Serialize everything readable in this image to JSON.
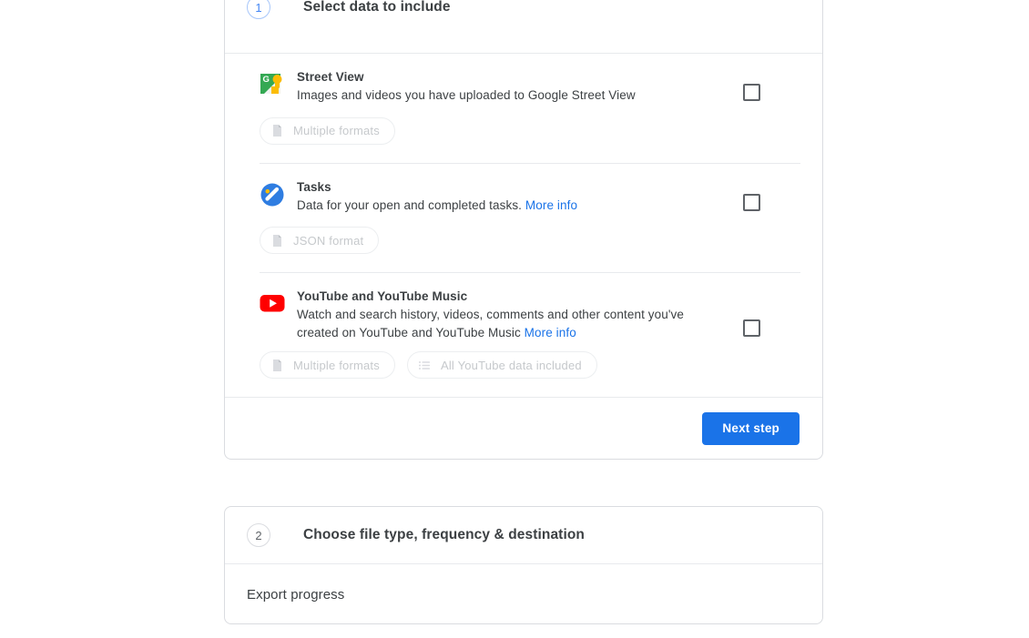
{
  "step1": {
    "number": "1",
    "title": "Select data to include",
    "services": [
      {
        "icon": "street-view-icon",
        "name": "Street View",
        "desc": "Images and videos you have uploaded to Google Street View",
        "more_info": "",
        "checked": false,
        "chips": [
          {
            "icon": "document-icon",
            "label": "Multiple formats"
          }
        ]
      },
      {
        "icon": "tasks-icon",
        "name": "Tasks",
        "desc": "Data for your open and completed tasks. ",
        "more_info": "More info",
        "checked": false,
        "chips": [
          {
            "icon": "document-icon",
            "label": "JSON format"
          }
        ]
      },
      {
        "icon": "youtube-icon",
        "name": "YouTube and YouTube Music",
        "desc": "Watch and search history, videos, comments and other content you've created on YouTube and YouTube Music ",
        "more_info": "More info",
        "checked": false,
        "chips": [
          {
            "icon": "document-icon",
            "label": "Multiple formats"
          },
          {
            "icon": "list-icon",
            "label": "All YouTube data included"
          }
        ]
      }
    ],
    "next_button": "Next step"
  },
  "step2": {
    "number": "2",
    "title": "Choose file type, frequency & destination"
  },
  "export_progress": {
    "label": "Export progress"
  },
  "colors": {
    "accent": "#1a73e8",
    "step_active": "#4285f4",
    "link": "#1a73e8",
    "text": "#3c4043",
    "chip_text": "#c6c9cc",
    "border": "#dadce0",
    "divider": "#e8eaed",
    "youtube_red": "#ff0000"
  }
}
